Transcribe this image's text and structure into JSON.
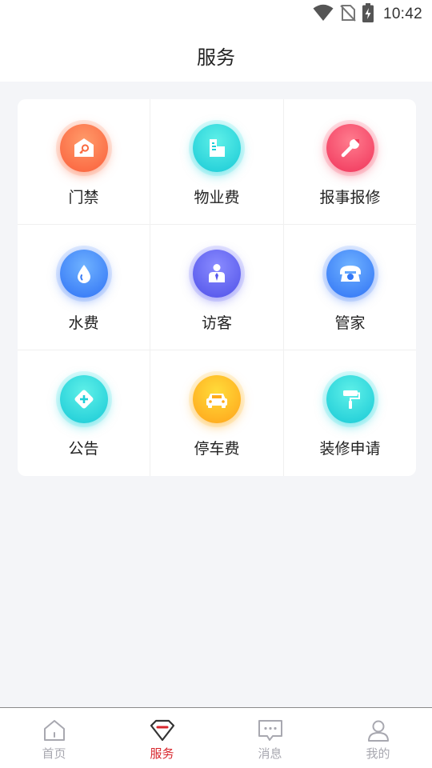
{
  "status_bar": {
    "time": "10:42",
    "icons": [
      "wifi-icon",
      "no-sim-icon",
      "battery-charging-icon"
    ]
  },
  "header": {
    "title": "服务"
  },
  "services": [
    {
      "label": "门禁",
      "icon": "house-key-icon",
      "color": "#fa6a40"
    },
    {
      "label": "物业费",
      "icon": "building-icon",
      "color": "#1ecfd8"
    },
    {
      "label": "报事报修",
      "icon": "wrench-icon",
      "color": "#f2405e"
    },
    {
      "label": "水费",
      "icon": "water-drop-icon",
      "color": "#3478f6"
    },
    {
      "label": "访客",
      "icon": "visitor-icon",
      "color": "#5657ec"
    },
    {
      "label": "管家",
      "icon": "telephone-icon",
      "color": "#3478f6"
    },
    {
      "label": "公告",
      "icon": "announcement-icon",
      "color": "#1ecfd8"
    },
    {
      "label": "停车费",
      "icon": "car-icon",
      "color": "#ffaa1c"
    },
    {
      "label": "装修申请",
      "icon": "paint-roller-icon",
      "color": "#1ecfd8"
    }
  ],
  "tab_bar": {
    "items": [
      {
        "label": "首页",
        "icon": "home-icon",
        "active": false
      },
      {
        "label": "服务",
        "icon": "service-icon",
        "active": true
      },
      {
        "label": "消息",
        "icon": "message-icon",
        "active": false
      },
      {
        "label": "我的",
        "icon": "profile-icon",
        "active": false
      }
    ],
    "active_color": "#d8262c",
    "inactive_color": "#a8a8b0"
  }
}
